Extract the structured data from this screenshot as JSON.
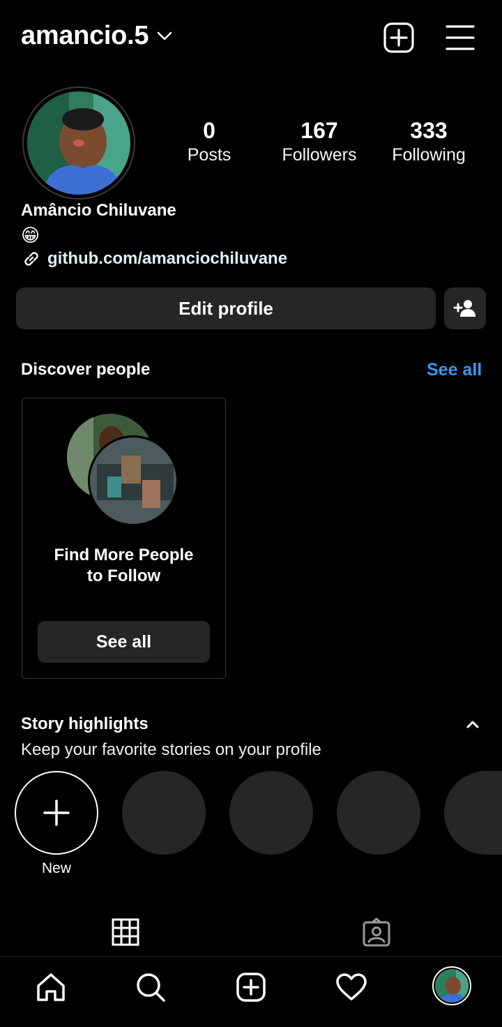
{
  "header": {
    "username": "amancio.5",
    "icons": [
      "chevron-down-icon",
      "add-post-icon",
      "menu-icon"
    ]
  },
  "profile": {
    "stats": [
      {
        "value": "0",
        "label": "Posts"
      },
      {
        "value": "167",
        "label": "Followers"
      },
      {
        "value": "333",
        "label": "Following"
      }
    ],
    "full_name": "Amâncio Chiluvane",
    "bio_emoji": "😁",
    "link": "github.com/amanciochiluvane"
  },
  "actions": {
    "edit_profile": "Edit profile"
  },
  "discover": {
    "title": "Discover people",
    "see_all": "See all",
    "card_text_line1": "Find More People",
    "card_text_line2": "to Follow",
    "card_button": "See all"
  },
  "highlights": {
    "title": "Story highlights",
    "subtitle": "Keep your favorite stories on your profile",
    "new_label": "New"
  },
  "colors": {
    "background": "#000000",
    "accent": "#3897f0",
    "surface": "#262626"
  },
  "bottom_nav": [
    "home-icon",
    "search-icon",
    "create-icon",
    "activity-icon",
    "profile-avatar"
  ]
}
